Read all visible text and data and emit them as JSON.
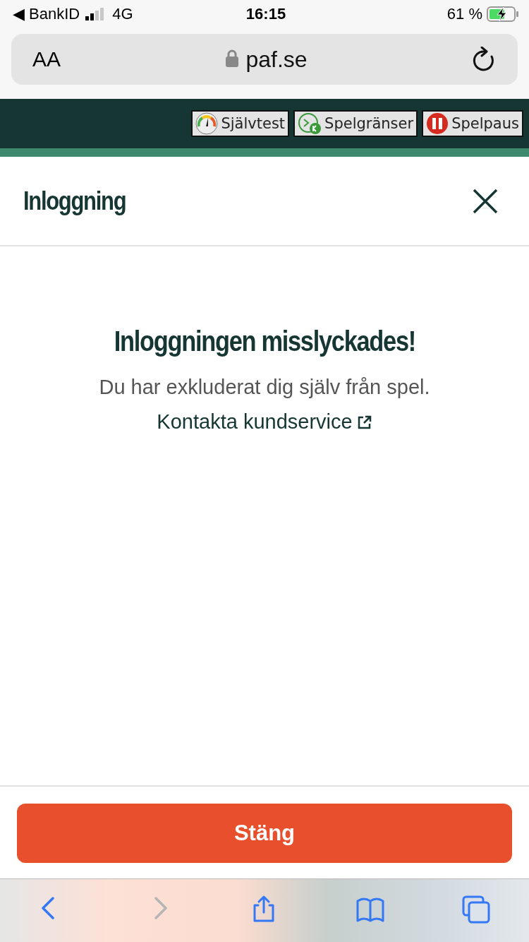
{
  "status_bar": {
    "back_app": "◀ BankID",
    "network": "4G",
    "time": "16:15",
    "battery": "61 %",
    "charging": true
  },
  "address_bar": {
    "text_size": "AA",
    "url": "paf.se",
    "secure": true
  },
  "site_header": {
    "buttons": [
      {
        "label": "Självtest",
        "kind": "gauge"
      },
      {
        "label": "Spelgränser",
        "kind": "clock"
      },
      {
        "label": "Spelpaus",
        "kind": "pause"
      }
    ]
  },
  "modal": {
    "title": "Inloggning",
    "heading": "Inloggningen misslyckades!",
    "message": "Du har exkluderat dig själv från spel.",
    "link": "Kontakta kundservice",
    "button": "Stäng"
  },
  "toolbar": {
    "items": [
      {
        "kind": "back",
        "disabled": false
      },
      {
        "kind": "forward",
        "disabled": true
      },
      {
        "kind": "share",
        "disabled": false
      },
      {
        "kind": "bookmarks",
        "disabled": false
      },
      {
        "kind": "tabs",
        "disabled": false
      }
    ]
  }
}
